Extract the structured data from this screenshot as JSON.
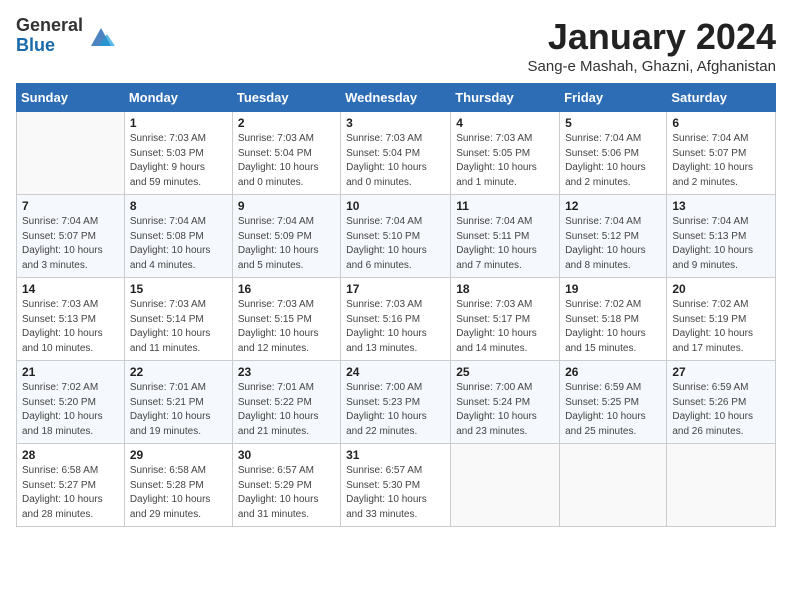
{
  "logo": {
    "general": "General",
    "blue": "Blue"
  },
  "title": "January 2024",
  "location": "Sang-e Mashah, Ghazni, Afghanistan",
  "days_of_week": [
    "Sunday",
    "Monday",
    "Tuesday",
    "Wednesday",
    "Thursday",
    "Friday",
    "Saturday"
  ],
  "weeks": [
    [
      {
        "day": "",
        "info": ""
      },
      {
        "day": "1",
        "info": "Sunrise: 7:03 AM\nSunset: 5:03 PM\nDaylight: 9 hours\nand 59 minutes."
      },
      {
        "day": "2",
        "info": "Sunrise: 7:03 AM\nSunset: 5:04 PM\nDaylight: 10 hours\nand 0 minutes."
      },
      {
        "day": "3",
        "info": "Sunrise: 7:03 AM\nSunset: 5:04 PM\nDaylight: 10 hours\nand 0 minutes."
      },
      {
        "day": "4",
        "info": "Sunrise: 7:03 AM\nSunset: 5:05 PM\nDaylight: 10 hours\nand 1 minute."
      },
      {
        "day": "5",
        "info": "Sunrise: 7:04 AM\nSunset: 5:06 PM\nDaylight: 10 hours\nand 2 minutes."
      },
      {
        "day": "6",
        "info": "Sunrise: 7:04 AM\nSunset: 5:07 PM\nDaylight: 10 hours\nand 2 minutes."
      }
    ],
    [
      {
        "day": "7",
        "info": "Sunrise: 7:04 AM\nSunset: 5:07 PM\nDaylight: 10 hours\nand 3 minutes."
      },
      {
        "day": "8",
        "info": "Sunrise: 7:04 AM\nSunset: 5:08 PM\nDaylight: 10 hours\nand 4 minutes."
      },
      {
        "day": "9",
        "info": "Sunrise: 7:04 AM\nSunset: 5:09 PM\nDaylight: 10 hours\nand 5 minutes."
      },
      {
        "day": "10",
        "info": "Sunrise: 7:04 AM\nSunset: 5:10 PM\nDaylight: 10 hours\nand 6 minutes."
      },
      {
        "day": "11",
        "info": "Sunrise: 7:04 AM\nSunset: 5:11 PM\nDaylight: 10 hours\nand 7 minutes."
      },
      {
        "day": "12",
        "info": "Sunrise: 7:04 AM\nSunset: 5:12 PM\nDaylight: 10 hours\nand 8 minutes."
      },
      {
        "day": "13",
        "info": "Sunrise: 7:04 AM\nSunset: 5:13 PM\nDaylight: 10 hours\nand 9 minutes."
      }
    ],
    [
      {
        "day": "14",
        "info": "Sunrise: 7:03 AM\nSunset: 5:13 PM\nDaylight: 10 hours\nand 10 minutes."
      },
      {
        "day": "15",
        "info": "Sunrise: 7:03 AM\nSunset: 5:14 PM\nDaylight: 10 hours\nand 11 minutes."
      },
      {
        "day": "16",
        "info": "Sunrise: 7:03 AM\nSunset: 5:15 PM\nDaylight: 10 hours\nand 12 minutes."
      },
      {
        "day": "17",
        "info": "Sunrise: 7:03 AM\nSunset: 5:16 PM\nDaylight: 10 hours\nand 13 minutes."
      },
      {
        "day": "18",
        "info": "Sunrise: 7:03 AM\nSunset: 5:17 PM\nDaylight: 10 hours\nand 14 minutes."
      },
      {
        "day": "19",
        "info": "Sunrise: 7:02 AM\nSunset: 5:18 PM\nDaylight: 10 hours\nand 15 minutes."
      },
      {
        "day": "20",
        "info": "Sunrise: 7:02 AM\nSunset: 5:19 PM\nDaylight: 10 hours\nand 17 minutes."
      }
    ],
    [
      {
        "day": "21",
        "info": "Sunrise: 7:02 AM\nSunset: 5:20 PM\nDaylight: 10 hours\nand 18 minutes."
      },
      {
        "day": "22",
        "info": "Sunrise: 7:01 AM\nSunset: 5:21 PM\nDaylight: 10 hours\nand 19 minutes."
      },
      {
        "day": "23",
        "info": "Sunrise: 7:01 AM\nSunset: 5:22 PM\nDaylight: 10 hours\nand 21 minutes."
      },
      {
        "day": "24",
        "info": "Sunrise: 7:00 AM\nSunset: 5:23 PM\nDaylight: 10 hours\nand 22 minutes."
      },
      {
        "day": "25",
        "info": "Sunrise: 7:00 AM\nSunset: 5:24 PM\nDaylight: 10 hours\nand 23 minutes."
      },
      {
        "day": "26",
        "info": "Sunrise: 6:59 AM\nSunset: 5:25 PM\nDaylight: 10 hours\nand 25 minutes."
      },
      {
        "day": "27",
        "info": "Sunrise: 6:59 AM\nSunset: 5:26 PM\nDaylight: 10 hours\nand 26 minutes."
      }
    ],
    [
      {
        "day": "28",
        "info": "Sunrise: 6:58 AM\nSunset: 5:27 PM\nDaylight: 10 hours\nand 28 minutes."
      },
      {
        "day": "29",
        "info": "Sunrise: 6:58 AM\nSunset: 5:28 PM\nDaylight: 10 hours\nand 29 minutes."
      },
      {
        "day": "30",
        "info": "Sunrise: 6:57 AM\nSunset: 5:29 PM\nDaylight: 10 hours\nand 31 minutes."
      },
      {
        "day": "31",
        "info": "Sunrise: 6:57 AM\nSunset: 5:30 PM\nDaylight: 10 hours\nand 33 minutes."
      },
      {
        "day": "",
        "info": ""
      },
      {
        "day": "",
        "info": ""
      },
      {
        "day": "",
        "info": ""
      }
    ]
  ]
}
